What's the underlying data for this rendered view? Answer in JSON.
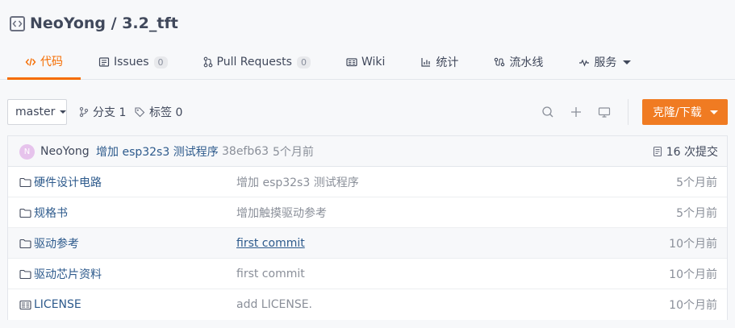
{
  "repo": {
    "title": "NeoYong / 3.2_tft"
  },
  "tabs": [
    {
      "label": "代码",
      "icon": "code-icon"
    },
    {
      "label": "Issues",
      "badge": "0",
      "icon": "issues-icon"
    },
    {
      "label": "Pull Requests",
      "badge": "0",
      "icon": "pull-request-icon"
    },
    {
      "label": "Wiki",
      "icon": "wiki-icon"
    },
    {
      "label": "统计",
      "icon": "stats-icon"
    },
    {
      "label": "流水线",
      "icon": "pipeline-icon"
    },
    {
      "label": "服务",
      "icon": "pulse-icon"
    }
  ],
  "toolbar": {
    "branch": "master",
    "branches_label": "分支 1",
    "tags_label": "标签 0",
    "clone_label": "克隆/下载"
  },
  "commit": {
    "avatar_letter": "N",
    "author": "NeoYong",
    "message": "增加 esp32s3 测试程序",
    "sha": "38efb63",
    "time": "5个月前",
    "count_label": "16 次提交"
  },
  "files": [
    {
      "name": "硬件设计电路",
      "type": "folder",
      "message": "增加 esp32s3 测试程序",
      "time": "5个月前"
    },
    {
      "name": "规格书",
      "type": "folder",
      "message": "增加触摸驱动参考",
      "time": "5个月前"
    },
    {
      "name": "驱动参考",
      "type": "folder",
      "message": "first commit",
      "time": "10个月前"
    },
    {
      "name": "驱动芯片资料",
      "type": "folder",
      "message": "first commit",
      "time": "10个月前"
    },
    {
      "name": "LICENSE",
      "type": "file",
      "message": "add LICENSE.",
      "time": "10个月前"
    }
  ],
  "colors": {
    "accent": "#f56c00",
    "clone_button": "#f07b22",
    "link": "#2d5a8c"
  }
}
